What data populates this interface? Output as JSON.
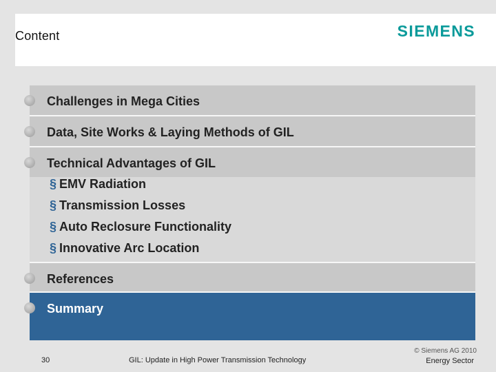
{
  "header": {
    "title": "Content",
    "brand": "SIEMENS"
  },
  "toc": {
    "challenges": "Challenges in Mega Cities",
    "data_site": "Data, Site Works & Laying Methods of GIL",
    "technical": "Technical Advantages of GIL",
    "sub_marker": "§",
    "sub_items": [
      "EMV Radiation",
      "Transmission Losses",
      "Auto Reclosure Functionality",
      "Innovative Arc Location"
    ],
    "references": "References",
    "summary": "Summary"
  },
  "footer": {
    "page": "30",
    "title": "GIL: Update in High Power Transmission Technology",
    "copyright": "© Siemens AG 2010",
    "sector": "Energy Sector"
  },
  "colors": {
    "accent": "#2f6496",
    "brand": "#0a9a9a"
  }
}
